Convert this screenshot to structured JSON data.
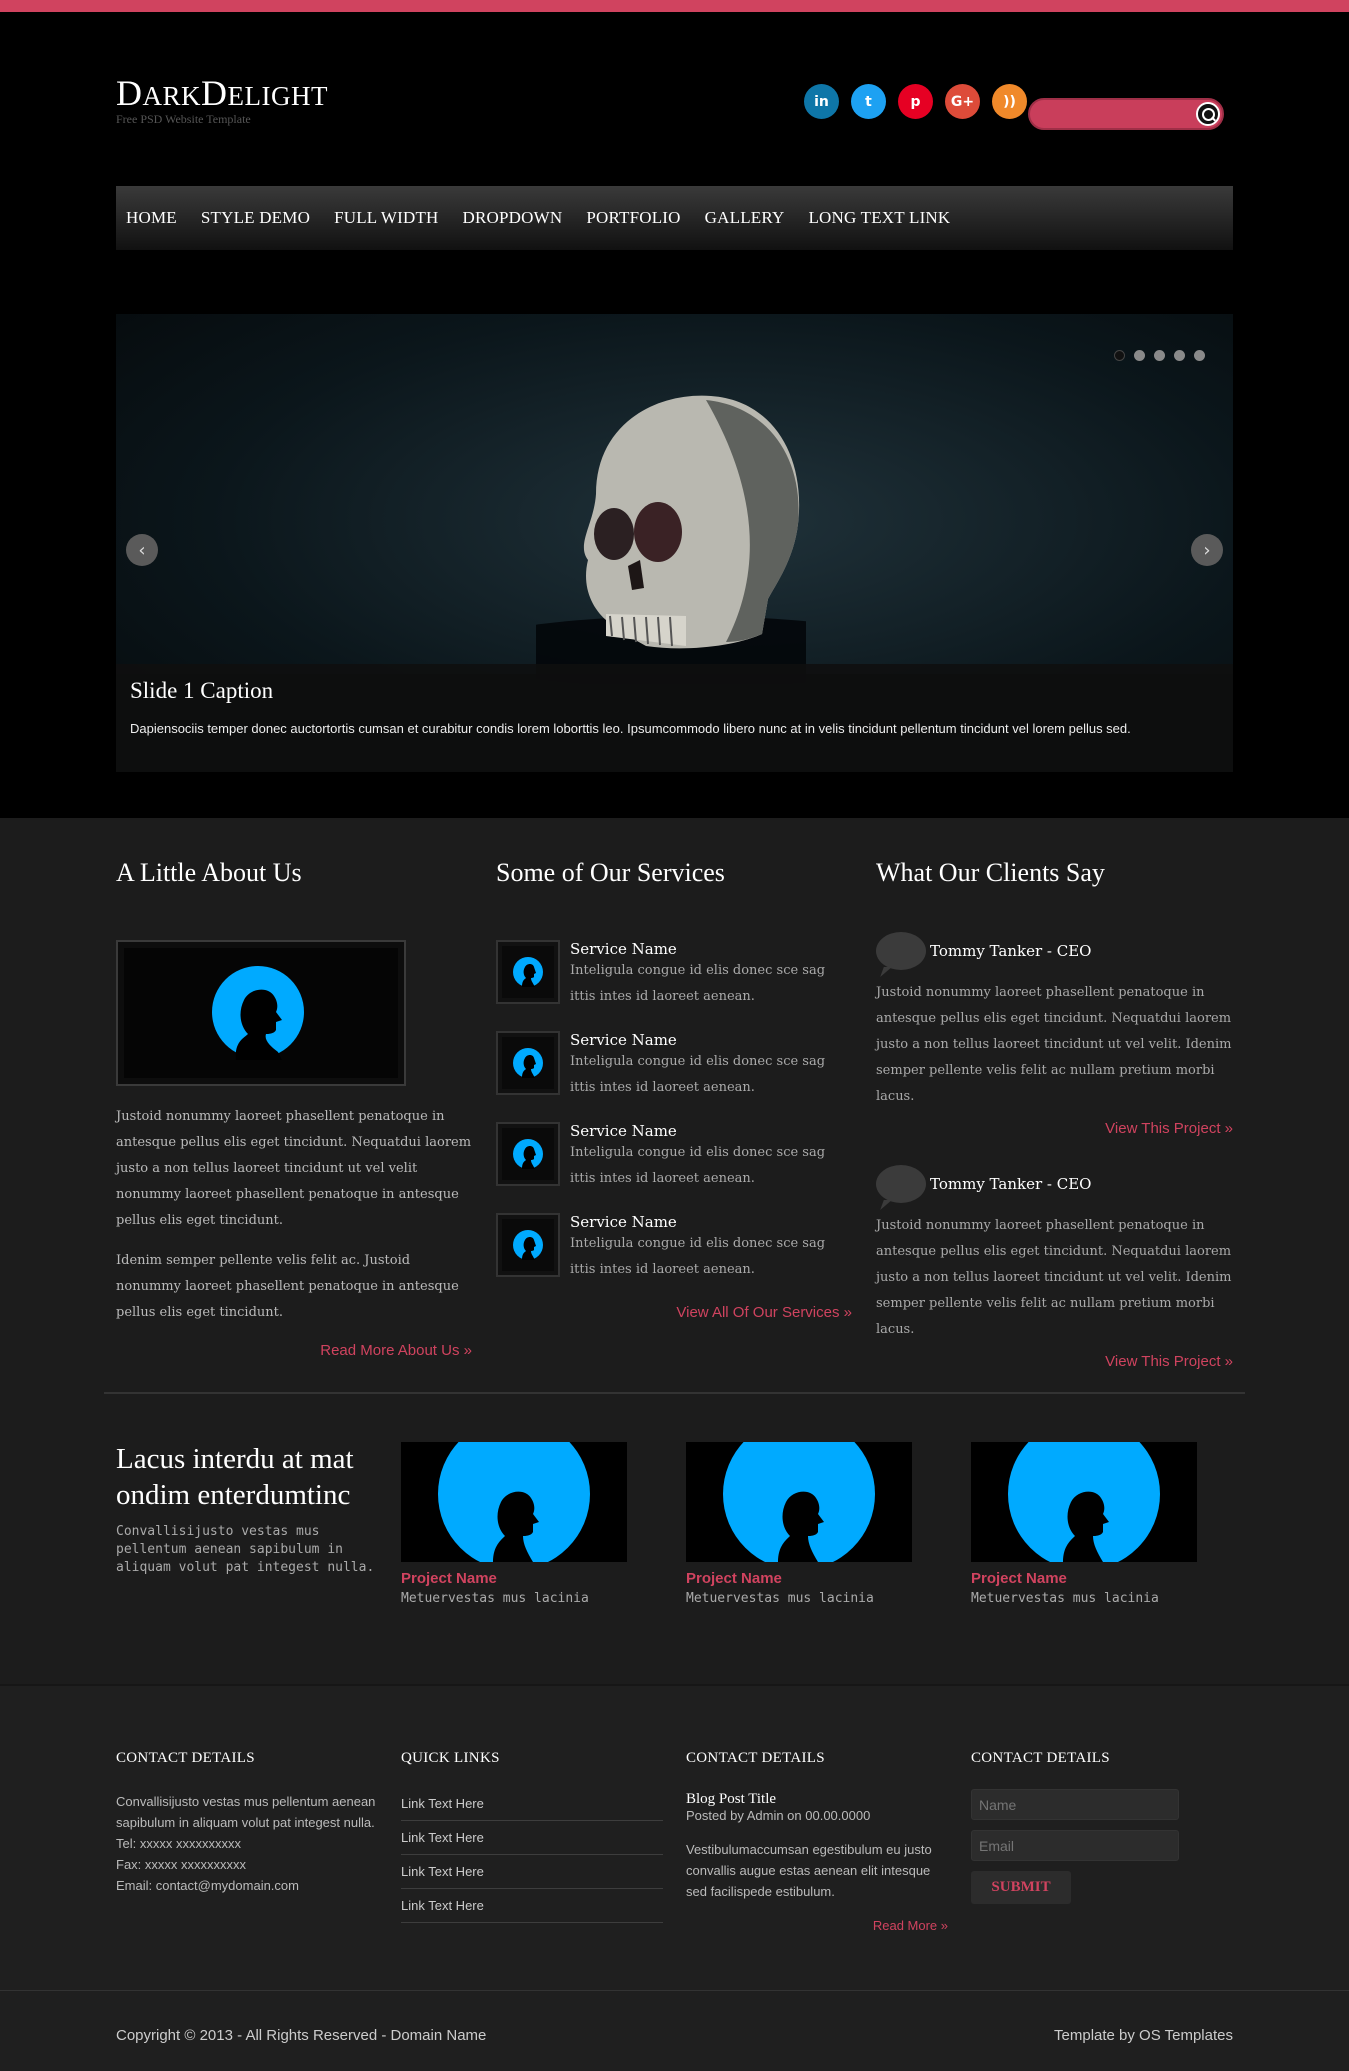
{
  "colors": {
    "accent": "#d0435f",
    "background": "#000000",
    "content_bg": "#1c1c1c",
    "avatar_blue": "#00aaff"
  },
  "header": {
    "logo_first": "D",
    "logo_mid": "ARK",
    "logo_second": "D",
    "logo_end": "ELIGHT",
    "tagline": "Free PSD Website Template",
    "social": [
      {
        "icon": "linkedin-icon",
        "glyph": "in",
        "color": "#0e76a8"
      },
      {
        "icon": "twitter-icon",
        "glyph": "t",
        "color": "#1da1f2"
      },
      {
        "icon": "pinterest-icon",
        "glyph": "p",
        "color": "#e60023"
      },
      {
        "icon": "google-plus-icon",
        "glyph": "G+",
        "color": "#dd4b39"
      },
      {
        "icon": "rss-icon",
        "glyph": "))",
        "color": "#f0892a"
      }
    ],
    "search_placeholder": ""
  },
  "nav": [
    "HOME",
    "STYLE DEMO",
    "FULL WIDTH",
    "DROPDOWN",
    "PORTFOLIO",
    "GALLERY",
    "LONG TEXT LINK"
  ],
  "slider": {
    "caption_title": "Slide 1 Caption",
    "caption_text": "Dapiensociis temper donec auctortortis cumsan et curabitur condis lorem loborttis leo. Ipsumcommodo libero nunc at in velis tincidunt pellentum tincidunt vel lorem pellus sed.",
    "slide_count": 5,
    "active_slide": 1
  },
  "about": {
    "title": "A Little About Us",
    "p1": "Justoid nonummy laoreet phasellent penatoque in antesque pellus elis eget tincidunt. Nequatdui laorem justo a non tellus laoreet tincidunt ut vel velit nonummy laoreet phasellent penatoque in antesque pellus elis eget tincidunt.",
    "p2": "Idenim semper pellente velis felit ac. Justoid nonummy laoreet phasellent penatoque in antesque pellus elis eget tincidunt.",
    "link": "Read More About Us »"
  },
  "services": {
    "title": "Some of Our Services",
    "items": [
      {
        "name": "Service Name",
        "desc": "Inteligula congue id elis donec sce sag ittis intes id laoreet aenean."
      },
      {
        "name": "Service Name",
        "desc": "Inteligula congue id elis donec sce sag ittis intes id laoreet aenean."
      },
      {
        "name": "Service Name",
        "desc": "Inteligula congue id elis donec sce sag ittis intes id laoreet aenean."
      },
      {
        "name": "Service Name",
        "desc": "Inteligula congue id elis donec sce sag ittis intes id laoreet aenean."
      }
    ],
    "link": "View All Of Our Services »"
  },
  "clients": {
    "title": "What Our Clients Say",
    "items": [
      {
        "name": "Tommy Tanker - CEO",
        "text": "Justoid nonummy laoreet phasellent penatoque in antesque pellus elis eget tincidunt. Nequatdui laorem justo a non tellus laoreet tincidunt ut vel velit. Idenim semper pellente velis felit ac nullam pretium morbi lacus.",
        "link": "View This Project »"
      },
      {
        "name": "Tommy Tanker - CEO",
        "text": "Justoid nonummy laoreet phasellent penatoque in antesque pellus elis eget tincidunt. Nequatdui laorem justo a non tellus laoreet tincidunt ut vel velit. Idenim semper pellente velis felit ac nullam pretium morbi lacus.",
        "link": "View This Project »"
      }
    ]
  },
  "promo": {
    "title": "Lacus interdu at mat ondim enterdumtinc",
    "text": "Convallisijusto vestas mus pellentum aenean sapibulum in aliquam volut pat integest nulla."
  },
  "projects": [
    {
      "name": "Project Name",
      "desc": "Metuervestas mus lacinia"
    },
    {
      "name": "Project Name",
      "desc": "Metuervestas mus lacinia"
    },
    {
      "name": "Project Name",
      "desc": "Metuervestas mus lacinia"
    }
  ],
  "footer": {
    "contact": {
      "title": "CONTACT DETAILS",
      "text": "Convallisijusto vestas mus pellentum aenean sapibulum in aliquam volut pat integest nulla.",
      "tel": "Tel: xxxxx xxxxxxxxxx",
      "fax": "Fax: xxxxx xxxxxxxxxx",
      "email": "Email: contact@mydomain.com"
    },
    "quick_links": {
      "title": "QUICK LINKS",
      "items": [
        "Link Text Here",
        "Link Text Here",
        "Link Text Here",
        "Link Text Here"
      ]
    },
    "blog": {
      "title": "CONTACT DETAILS",
      "post_title": "Blog Post Title",
      "meta": "Posted by Admin on 00.00.0000",
      "text": "Vestibulumaccumsan egestibulum eu justo convallis augue estas aenean elit intesque sed facilispede estibulum.",
      "link": "Read More »"
    },
    "form": {
      "title": "CONTACT DETAILS",
      "name_placeholder": "Name",
      "email_placeholder": "Email",
      "submit": "SUBMIT"
    }
  },
  "copyright": {
    "left": "Copyright © 2013 - All Rights Reserved - Domain Name",
    "right": "Template by OS Templates"
  }
}
